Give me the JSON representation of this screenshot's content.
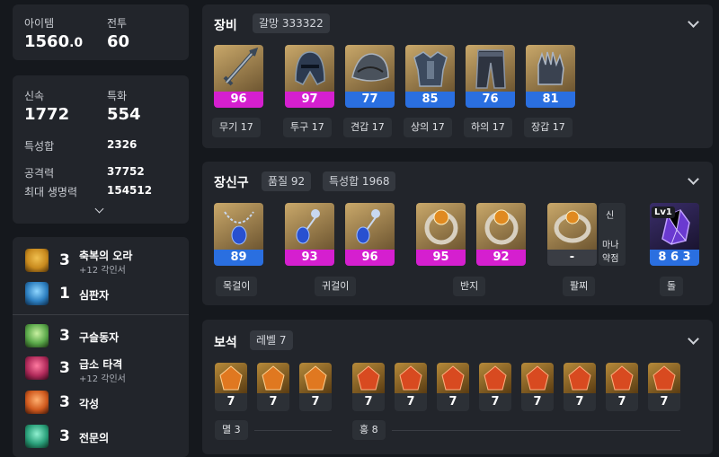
{
  "stats_top": {
    "item_label": "아이템",
    "item_value": "1560",
    "item_decimal": ".0",
    "combat_label": "전투",
    "combat_value": "60"
  },
  "stats_mid": {
    "swift_label": "신속",
    "swift_value": "1772",
    "crit_label": "특화",
    "crit_value": "554",
    "trait_sum_label": "특성합",
    "trait_sum_value": "2326",
    "attack_label": "공격력",
    "attack_value": "37752",
    "hp_label": "최대 생명력",
    "hp_value": "154512"
  },
  "engravings": [
    {
      "level": "3",
      "name": "축복의 오라",
      "sub": "+12 각인서",
      "icon_color": "#c88a1e"
    },
    {
      "level": "1",
      "name": "심판자",
      "sub": "",
      "icon_color": "#2d7fc0"
    },
    {
      "level": "3",
      "name": "구슬동자",
      "sub": "",
      "icon_color": "#5aa84a"
    },
    {
      "level": "3",
      "name": "급소 타격",
      "sub": "+12 각인서",
      "icon_color": "#b02a5a"
    },
    {
      "level": "3",
      "name": "각성",
      "sub": "",
      "icon_color": "#d05a1e"
    },
    {
      "level": "3",
      "name": "전문의",
      "sub": "",
      "icon_color": "#2aa07a"
    }
  ],
  "equipment": {
    "title": "장비",
    "chip": "갈망 333322",
    "items": [
      {
        "value": "96",
        "label": "무기 17",
        "color": "#d51fcf",
        "icon": "sword-icon"
      },
      {
        "value": "97",
        "label": "투구 17",
        "color": "#d51fcf",
        "icon": "helmet-icon"
      },
      {
        "value": "77",
        "label": "견갑 17",
        "color": "#2a6fe0",
        "icon": "shoulder-icon"
      },
      {
        "value": "85",
        "label": "상의 17",
        "color": "#2a6fe0",
        "icon": "chest-icon"
      },
      {
        "value": "76",
        "label": "하의 17",
        "color": "#2a6fe0",
        "icon": "pants-icon"
      },
      {
        "value": "81",
        "label": "장갑 17",
        "color": "#2a6fe0",
        "icon": "gloves-icon"
      }
    ]
  },
  "accessories": {
    "title": "장신구",
    "chip_quality": "품질 92",
    "chip_traits": "특성합 1968",
    "items": [
      {
        "value": "89",
        "color": "#2a6fe0",
        "icon": "necklace-icon"
      },
      {
        "value": "93",
        "color": "#d51fcf",
        "icon": "earring-icon"
      },
      {
        "value": "96",
        "color": "#d51fcf",
        "icon": "earring-icon"
      },
      {
        "value": "95",
        "color": "#d51fcf",
        "icon": "ring-icon"
      },
      {
        "value": "92",
        "color": "#d51fcf",
        "icon": "ring-icon"
      },
      {
        "value": "-",
        "color": "#3a3d44",
        "icon": "bracelet-icon"
      },
      {
        "value": "8 6 3",
        "color": "#2a6fe0",
        "icon": "stone-icon"
      }
    ],
    "labels": {
      "necklace": "목걸이",
      "earring": "귀걸이",
      "ring": "반지",
      "bracelet": "팔찌",
      "stone": "돌"
    },
    "bracelet_tags": [
      "신",
      "마나",
      "약점"
    ],
    "stone_badge": "Lv1"
  },
  "gems": {
    "title": "보석",
    "chip": "레벨 7",
    "left_values": [
      "7",
      "7",
      "7"
    ],
    "right_values": [
      "7",
      "7",
      "7",
      "7",
      "7",
      "7",
      "7",
      "7"
    ],
    "left_label": "멸 3",
    "right_label": "홍 8"
  }
}
